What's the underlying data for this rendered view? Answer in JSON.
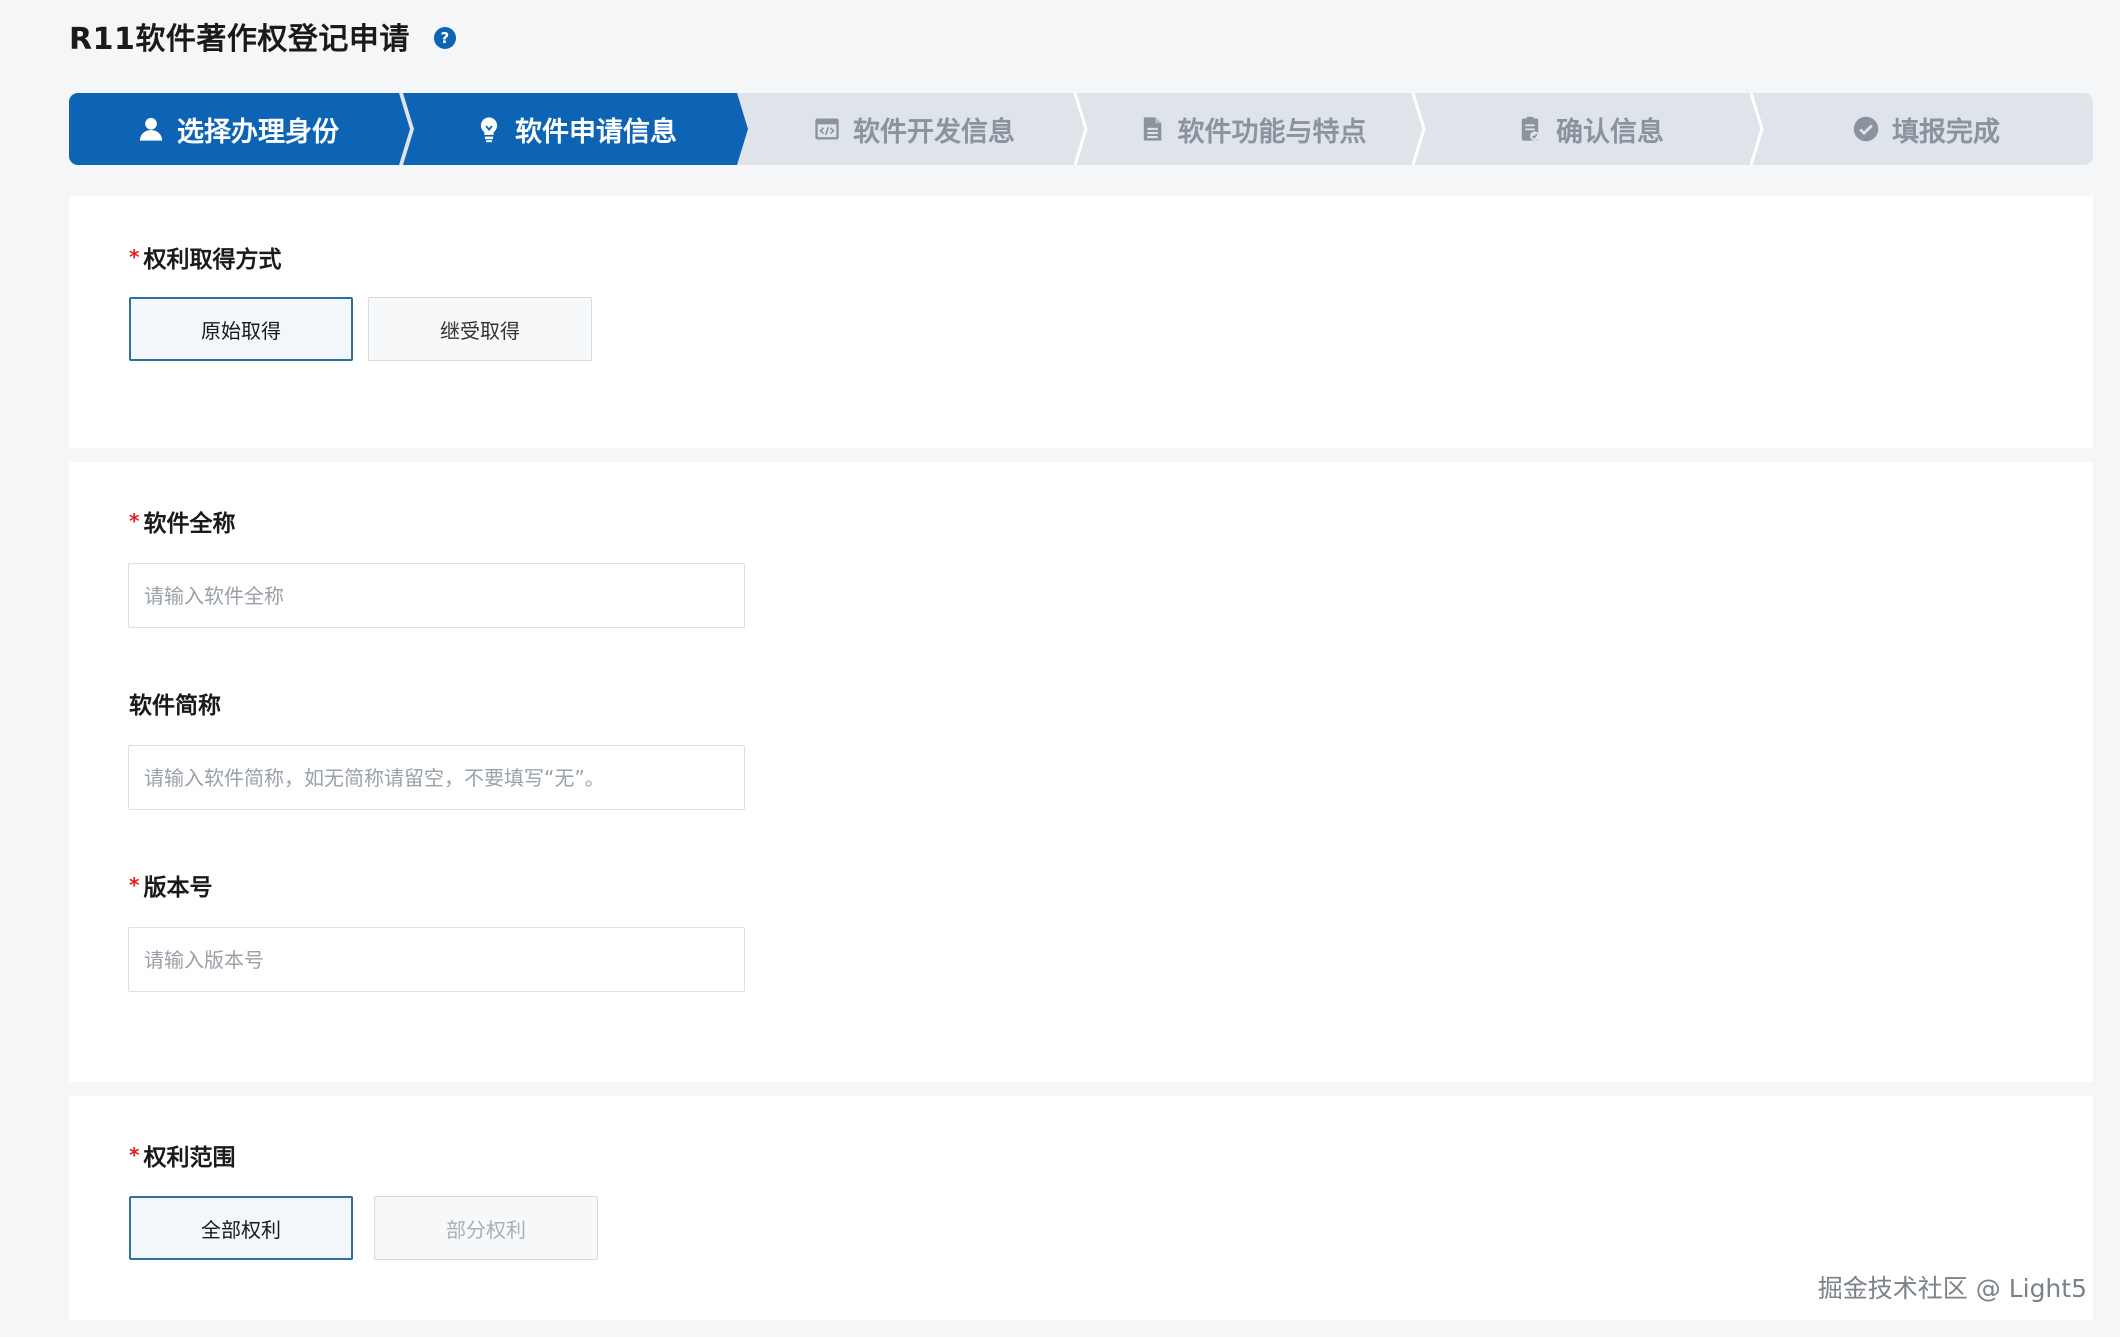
{
  "header": {
    "title": "R11软件著作权登记申请",
    "help_glyph": "?"
  },
  "steps": [
    {
      "label": "选择办理身份",
      "icon": "user-icon",
      "state": "active"
    },
    {
      "label": "软件申请信息",
      "icon": "lightbulb-icon",
      "state": "active"
    },
    {
      "label": "软件开发信息",
      "icon": "code-window-icon",
      "state": "inactive"
    },
    {
      "label": "软件功能与特点",
      "icon": "document-icon",
      "state": "inactive"
    },
    {
      "label": "确认信息",
      "icon": "clipboard-check-icon",
      "state": "inactive"
    },
    {
      "label": "填报完成",
      "icon": "check-circle-icon",
      "state": "inactive"
    }
  ],
  "colors": {
    "accent": "#0d63b4",
    "required": "#e02020",
    "inactive_step_bg": "#dfe4ea",
    "inactive_step_text": "#8a939e"
  },
  "rights_acquisition": {
    "required_mark": "*",
    "label": "权利取得方式",
    "options": [
      {
        "label": "原始取得",
        "selected": true
      },
      {
        "label": "继受取得",
        "selected": false
      }
    ]
  },
  "software_info": {
    "full_name": {
      "required_mark": "*",
      "label": "软件全称",
      "value": "",
      "placeholder": "请输入软件全称"
    },
    "short_name": {
      "label": "软件简称",
      "value": "",
      "placeholder": "请输入软件简称，如无简称请留空，不要填写“无”。"
    },
    "version": {
      "required_mark": "*",
      "label": "版本号",
      "value": "",
      "placeholder": "请输入版本号"
    }
  },
  "rights_scope": {
    "required_mark": "*",
    "label": "权利范围",
    "options": [
      {
        "label": "全部权利",
        "selected": true
      },
      {
        "label": "部分权利",
        "selected": false,
        "disabled": true
      }
    ]
  },
  "watermark": "掘金技术社区 @ Light5"
}
